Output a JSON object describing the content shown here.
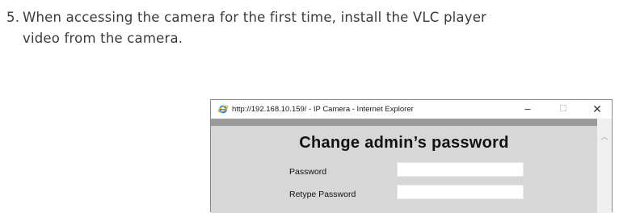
{
  "instruction": {
    "number": "5.",
    "line1": "When accessing the camera for the first time, install the VLC player",
    "line2": "video from the camera."
  },
  "browser": {
    "title": "http://192.168.10.159/ - IP Camera - Internet Explorer",
    "minimize_glyph": "–",
    "maximize_glyph": "☐",
    "close_glyph": "✕",
    "icon": "internet-explorer-icon"
  },
  "form": {
    "heading": "Change admin’s password",
    "password_label": "Password",
    "password_value": "",
    "retype_label": "Retype Password",
    "retype_value": ""
  },
  "colors": {
    "content_bg": "#d7d7d7",
    "top_bar": "#9a9a9a"
  }
}
